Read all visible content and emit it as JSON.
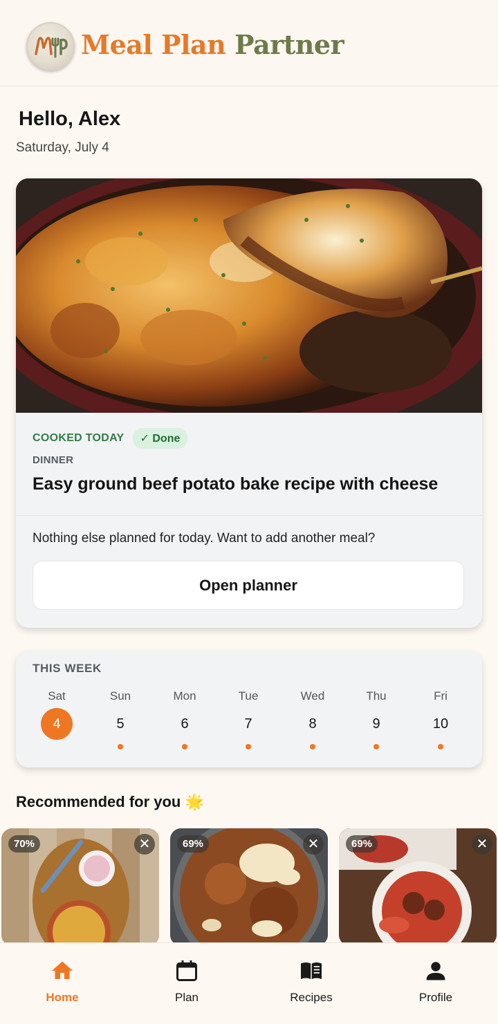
{
  "header": {
    "brand_part1": "Meal Plan",
    "brand_part2": "Partner",
    "logo_letters": "MP"
  },
  "greeting": "Hello, Alex",
  "date": "Saturday, July 4",
  "today": {
    "status": "COOKED TODAY",
    "badge": "✓ Done",
    "meal_type": "DINNER",
    "meal_title": "Easy ground beef potato bake recipe with cheese",
    "message": "Nothing else planned for today. Want to add another meal?",
    "button_label": "Open planner"
  },
  "week": {
    "label": "THIS WEEK",
    "days": [
      {
        "name": "Sat",
        "num": "4",
        "active": true,
        "planned": false
      },
      {
        "name": "Sun",
        "num": "5",
        "active": false,
        "planned": true
      },
      {
        "name": "Mon",
        "num": "6",
        "active": false,
        "planned": true
      },
      {
        "name": "Tue",
        "num": "7",
        "active": false,
        "planned": true
      },
      {
        "name": "Wed",
        "num": "8",
        "active": false,
        "planned": true
      },
      {
        "name": "Thu",
        "num": "9",
        "active": false,
        "planned": true
      },
      {
        "name": "Fri",
        "num": "10",
        "active": false,
        "planned": true
      }
    ]
  },
  "recommended": {
    "title": "Recommended for you 🌟",
    "cards": [
      {
        "match": "70%",
        "dismiss": "✕"
      },
      {
        "match": "69%",
        "dismiss": "✕"
      },
      {
        "match": "69%",
        "dismiss": "✕"
      }
    ]
  },
  "nav": {
    "items": [
      {
        "label": "Home",
        "icon": "home-icon"
      },
      {
        "label": "Plan",
        "icon": "calendar-icon"
      },
      {
        "label": "Recipes",
        "icon": "book-icon"
      },
      {
        "label": "Profile",
        "icon": "person-icon"
      }
    ]
  },
  "colors": {
    "accent": "#ef7722",
    "brand_orange": "#e47a2a",
    "brand_green": "#6c7a4c",
    "success": "#2f7d46"
  }
}
